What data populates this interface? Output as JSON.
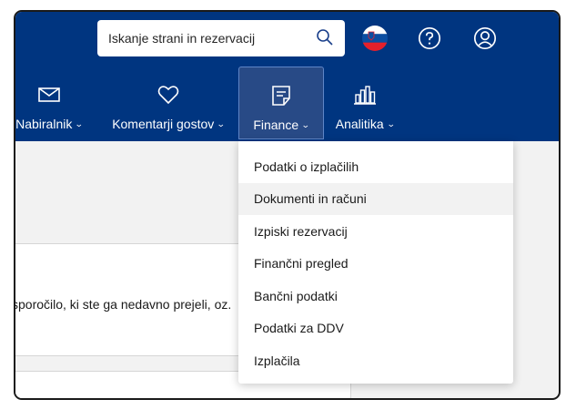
{
  "header": {
    "search_placeholder": "Iskanje strani in rezervacij",
    "brand_color": "#003580"
  },
  "nav": {
    "items": [
      {
        "label": "Nabiralnik",
        "icon": "envelope-icon"
      },
      {
        "label": "Komentarji gostov",
        "icon": "heart-icon"
      },
      {
        "label": "Finance",
        "icon": "document-icon",
        "active": true
      },
      {
        "label": "Analitika",
        "icon": "bar-chart-icon"
      }
    ]
  },
  "dropdown": {
    "items": [
      {
        "label": "Podatki o izplačilih"
      },
      {
        "label": "Dokumenti in računi",
        "highlighted": true
      },
      {
        "label": "Izpiski rezervacij"
      },
      {
        "label": "Finančni pregled"
      },
      {
        "label": "Bančni podatki"
      },
      {
        "label": "Podatki za DDV"
      },
      {
        "label": "Izplačila"
      }
    ]
  },
  "main": {
    "message_preview": "sporočilo, ki ste ga nedavno prejeli, oz."
  }
}
